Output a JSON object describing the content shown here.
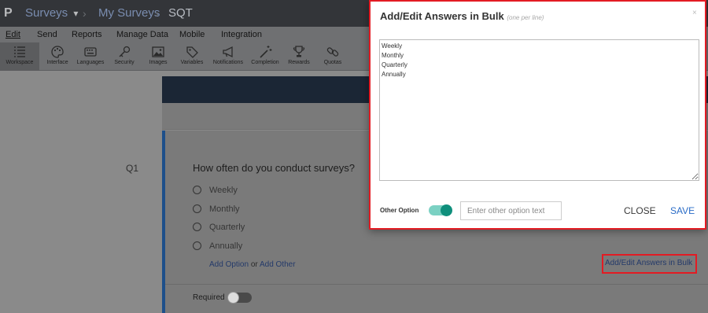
{
  "topbar": {
    "logo": "P",
    "breadcrumbs": [
      "Surveys",
      "My Surveys",
      "SQT"
    ],
    "caret": "▾",
    "separator": "›"
  },
  "menu": [
    "Edit",
    "Send",
    "Reports",
    "Manage Data",
    "Mobile",
    "Integration"
  ],
  "toolbar": [
    {
      "label": "Workspace",
      "icon": "workspace-icon"
    },
    {
      "label": "Interface",
      "icon": "palette-icon"
    },
    {
      "label": "Languages",
      "icon": "keyboard-icon"
    },
    {
      "label": "Security",
      "icon": "key-icon"
    },
    {
      "label": "Images",
      "icon": "image-icon"
    },
    {
      "label": "Variables",
      "icon": "tag-icon"
    },
    {
      "label": "Notifications",
      "icon": "megaphone-icon"
    },
    {
      "label": "Completion",
      "icon": "magic-wand-icon"
    },
    {
      "label": "Rewards",
      "icon": "trophy-icon"
    },
    {
      "label": "Quotas",
      "icon": "chain-icon"
    }
  ],
  "question": {
    "number": "Q1",
    "text": "How often do you conduct surveys?",
    "options": [
      "Weekly",
      "Monthly",
      "Quarterly",
      "Annually"
    ],
    "add_option": "Add Option",
    "or": "or",
    "add_other": "Add Other",
    "bulk_link": "Add/Edit Answers in Bulk",
    "required_label": "Required"
  },
  "modal": {
    "title": "Add/Edit Answers in Bulk",
    "hint": "(one per line)",
    "close_x": "×",
    "answers_text": "Weekly\nMonthly\nQuarterly\nAnnually",
    "other_label": "Other Option",
    "other_placeholder": "Enter other option text",
    "close_label": "CLOSE",
    "save_label": "SAVE"
  },
  "colors": {
    "accent_red": "#e31b23",
    "toggle_teal": "#0f8f7c",
    "save_blue": "#2a6cc7"
  }
}
